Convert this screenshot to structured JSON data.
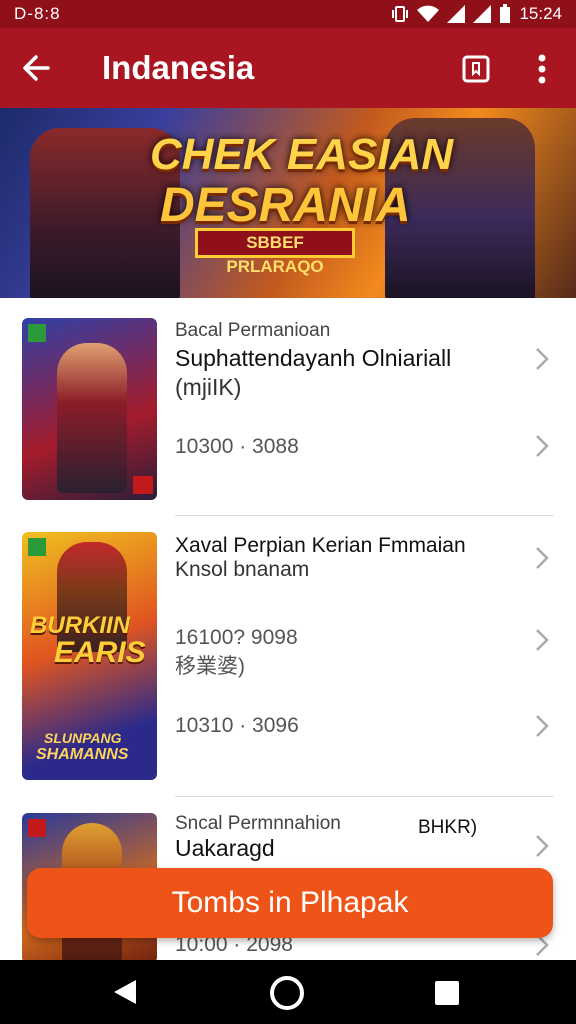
{
  "status_bar": {
    "left": "D-8:8",
    "time": "15:24"
  },
  "app_bar": {
    "title": "Indanesia"
  },
  "banner": {
    "line1": "CHEK EASIAN",
    "line2": "DESRANIA",
    "ribbon": "SBBEF PRLARAQO"
  },
  "items": [
    {
      "label": "Bacal Permanioan",
      "title": "Suphattendayanh Olniariall",
      "sub": "(mjiIK)",
      "meta": "10300 · 3088"
    },
    {
      "label": "Xaval Perpian Kerian Fmmaian",
      "title": "",
      "sub": "Knsol bnanam",
      "meta": "16100? 9098",
      "meta_sub": "移業婆)",
      "meta2": "10310 · 3096"
    },
    {
      "label": "Sncal Permnnahion",
      "title": "Uakaragd",
      "tag": "BHKR)",
      "meta": "10:00 · 2098"
    }
  ],
  "thumbs": {
    "t2_title1": "BURKIIN",
    "t2_title2": "EARIS",
    "t2_sub1": "SLUNPANG",
    "t2_sub2": "SHAMANNS"
  },
  "cta": {
    "label": "Tombs in Plhapak"
  },
  "colors": {
    "statusbar": "#8f1019",
    "appbar": "#a91520",
    "cta": "#ee5418"
  }
}
